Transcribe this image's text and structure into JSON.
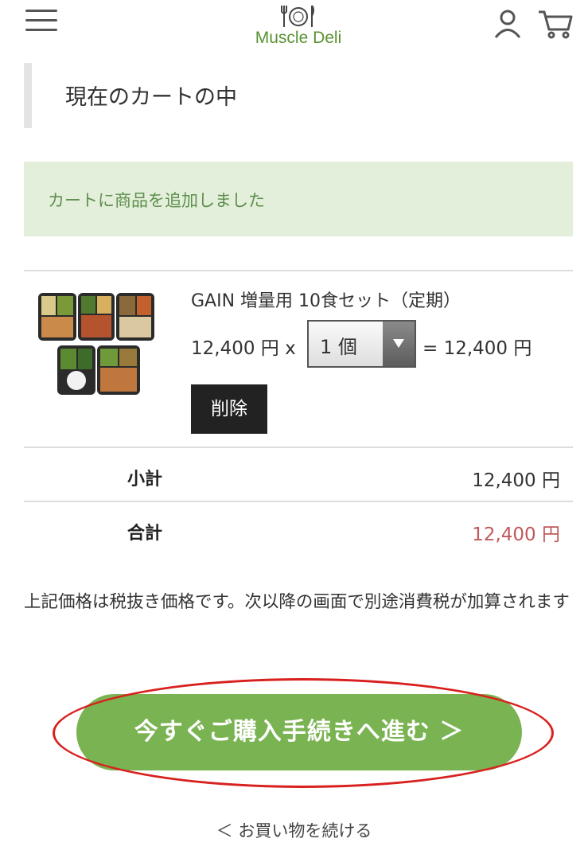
{
  "header": {
    "logo_text": "Muscle Deli",
    "icons": [
      "menu-icon",
      "user-icon",
      "cart-icon"
    ]
  },
  "page": {
    "title": "現在のカートの中"
  },
  "alert": {
    "message": "カートに商品を追加しました"
  },
  "cart": {
    "items": [
      {
        "name": "GAIN 増量用 10食セット（定期）",
        "unit_price": "12,400 円 x",
        "quantity": "1 個",
        "line_total": "= 12,400 円",
        "delete_label": "削除"
      }
    ],
    "subtotal_label": "小計",
    "subtotal_value": "12,400 円",
    "total_label": "合計",
    "total_value": "12,400 円"
  },
  "tax_note": "上記価格は税抜き価格です。次以降の画面で別途消費税が加算されます",
  "checkout_label": "今すぐご購入手続きへ進む ＞",
  "continue_label": "＜ お買い物を続ける",
  "colors": {
    "brand_green": "#7ab352",
    "alert_bg": "#e3efda",
    "alert_text": "#5e8f4e",
    "total_red": "#c0595b",
    "highlight_circle": "#d8211e"
  }
}
